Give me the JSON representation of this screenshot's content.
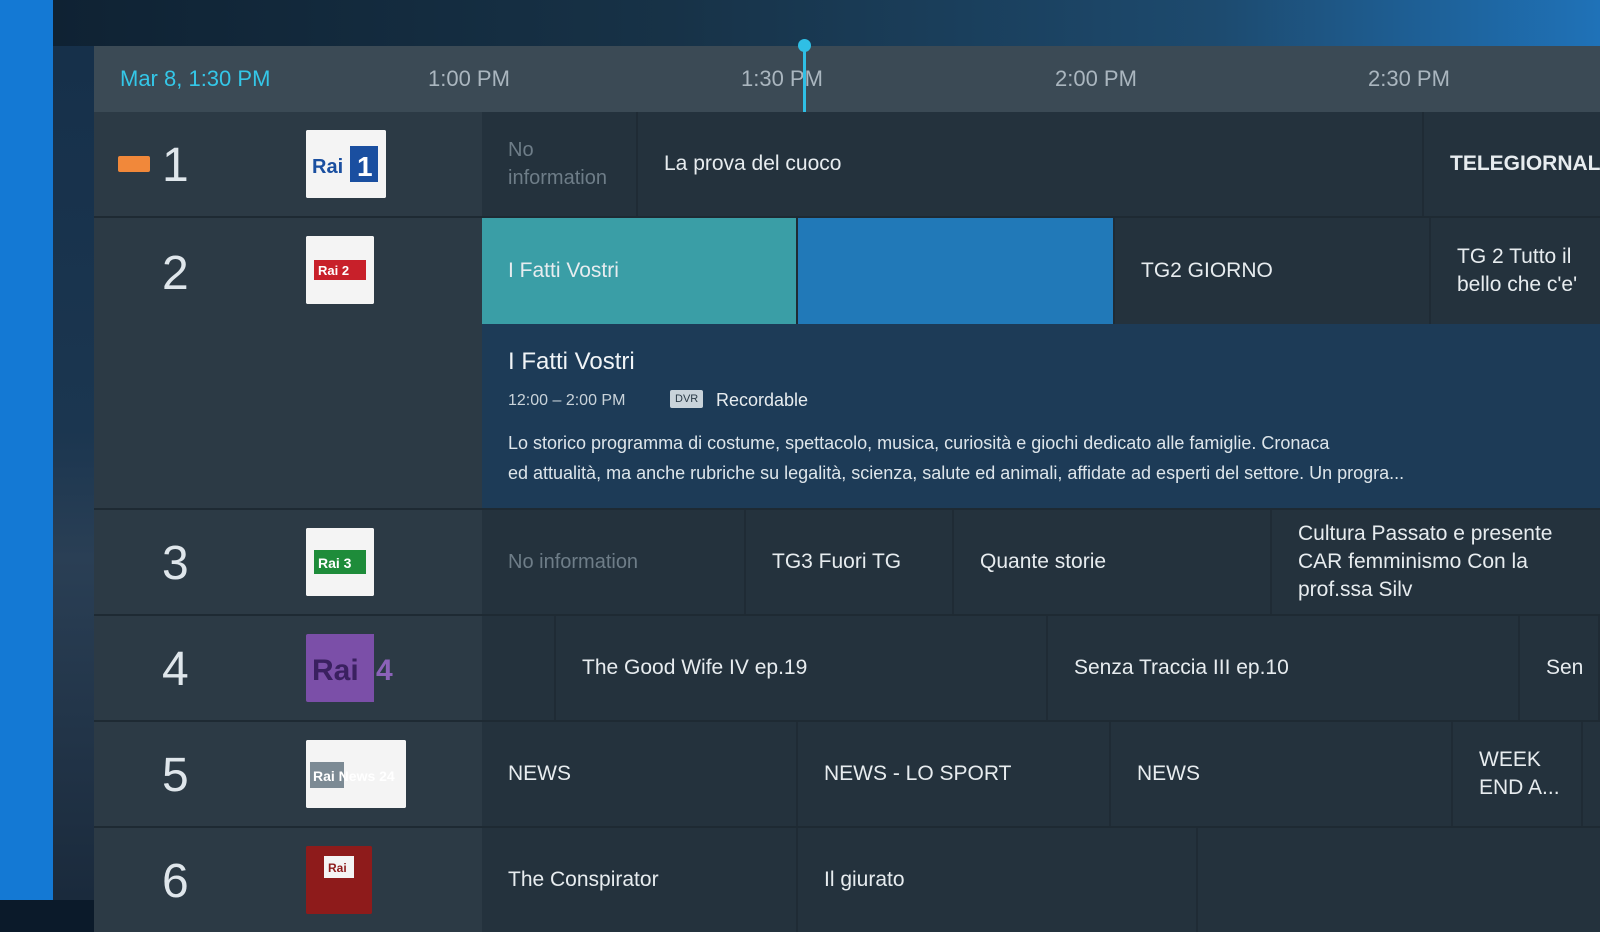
{
  "header": {
    "date_time": "Mar 8, 1:30 PM",
    "ticks": [
      "1:00 PM",
      "1:30 PM",
      "2:00 PM",
      "2:30 PM"
    ]
  },
  "channels": [
    {
      "number": "1",
      "logo_text": "Rai",
      "logo_badge": "1",
      "programs": [
        "No information",
        "La prova del cuoco",
        "TELEGIORNAL"
      ]
    },
    {
      "number": "2",
      "logo_text": "Rai 2",
      "programs": [
        "I Fatti Vostri",
        "TG2 GIORNO",
        "TG 2 Tutto il bello che c'e'"
      ]
    },
    {
      "number": "3",
      "logo_text": "Rai 3",
      "programs": [
        "No information",
        "TG3 Fuori TG",
        "Quante storie",
        "Cultura Passato e presente CAR femminismo Con la prof.ssa Silv"
      ]
    },
    {
      "number": "4",
      "logo_text": "Rai",
      "logo_badge": "4",
      "programs": [
        "",
        "The Good Wife IV ep.19",
        "Senza Traccia III ep.10",
        "Sen"
      ]
    },
    {
      "number": "5",
      "logo_text": "Rai News 24",
      "programs": [
        "NEWS",
        "NEWS - LO SPORT",
        "NEWS",
        "WEEK END A..."
      ]
    },
    {
      "number": "6",
      "logo_text": "Rai",
      "programs": [
        "The Conspirator",
        "Il giurato"
      ]
    }
  ],
  "details": {
    "title": "I Fatti Vostri",
    "time": "12:00 – 2:00 PM",
    "dvr_badge": "DVR",
    "recordable": "Recordable",
    "description_line1": "Lo storico programma di costume, spettacolo, musica, curiosità e giochi dedicato alle famiglie. Cronaca",
    "description_line2": "ed attualità, ma anche rubriche su legalità, scienza, salute ed animali, affidate ad esperti del settore. Un progra..."
  },
  "colors": {
    "accent": "#2fbfe5",
    "selected_past": "#3a9ea6",
    "selected_future": "#2179b8",
    "left_bar": "#1479d4",
    "rec_icon": "#f1883a"
  }
}
